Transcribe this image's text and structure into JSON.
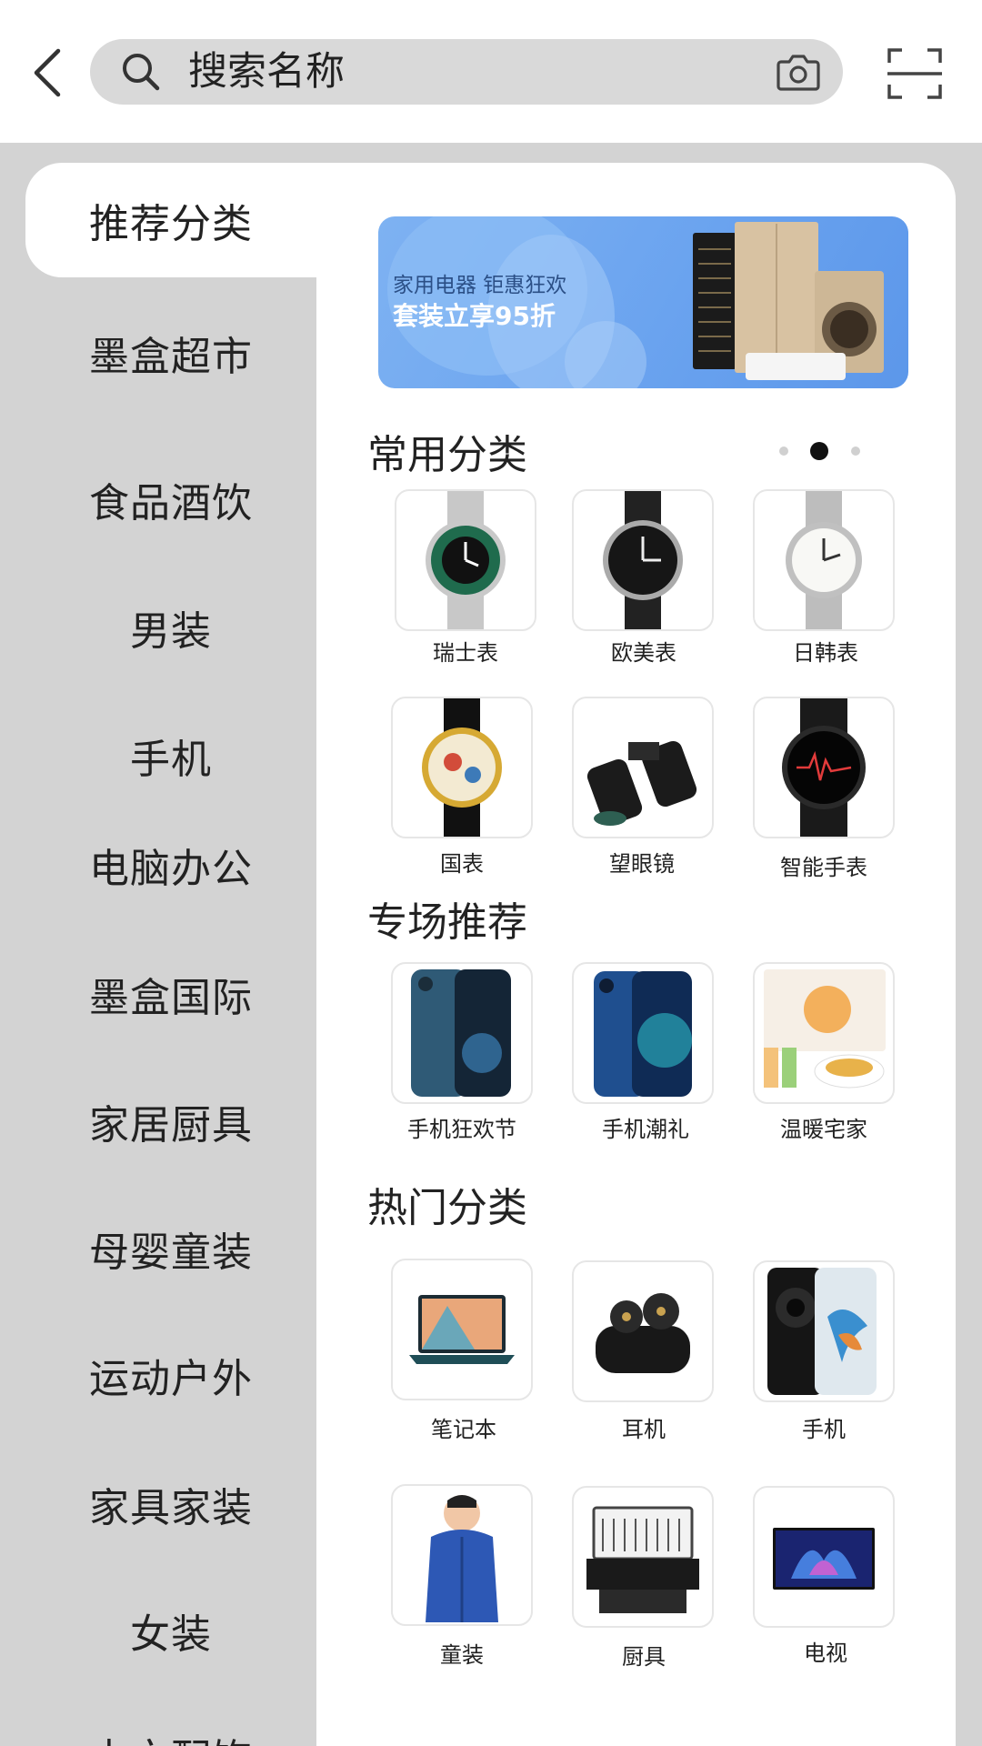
{
  "search": {
    "placeholder": "搜索名称"
  },
  "sidebar": {
    "items": [
      {
        "label": "推荐分类",
        "active": true
      },
      {
        "label": "墨盒超市"
      },
      {
        "label": "食品酒饮"
      },
      {
        "label": "男装"
      },
      {
        "label": "手机"
      },
      {
        "label": "电脑办公"
      },
      {
        "label": "墨盒国际"
      },
      {
        "label": "家居厨具"
      },
      {
        "label": "母婴童装"
      },
      {
        "label": "运动户外"
      },
      {
        "label": "家具家装"
      },
      {
        "label": "女装"
      },
      {
        "label": "中文配饰"
      }
    ]
  },
  "banner": {
    "line1": "家用电器 钜惠狂欢",
    "line2": "套装立享95折"
  },
  "sections": {
    "common": {
      "title": "常用分类",
      "active_page": 2,
      "pages": 3,
      "items": [
        {
          "label": "瑞士表",
          "icon": "watch-green-icon"
        },
        {
          "label": "欧美表",
          "icon": "watch-black-icon"
        },
        {
          "label": "日韩表",
          "icon": "watch-white-icon"
        },
        {
          "label": "国表",
          "icon": "watch-gold-icon"
        },
        {
          "label": "望眼镜",
          "icon": "binoculars-icon"
        },
        {
          "label": "智能手表",
          "icon": "smartwatch-icon"
        }
      ]
    },
    "special": {
      "title": "专场推荐",
      "items": [
        {
          "label": "手机狂欢节",
          "icon": "phone-blue-icon"
        },
        {
          "label": "手机潮礼",
          "icon": "phone-navy-icon"
        },
        {
          "label": "温暖宅家",
          "icon": "tea-box-icon"
        }
      ]
    },
    "hot": {
      "title": "热门分类",
      "items": [
        {
          "label": "笔记本",
          "icon": "laptop-icon"
        },
        {
          "label": "耳机",
          "icon": "earbuds-icon"
        },
        {
          "label": "手机",
          "icon": "phone-mate-icon"
        },
        {
          "label": "童装",
          "icon": "kids-jacket-icon"
        },
        {
          "label": "厨具",
          "icon": "dishwasher-icon"
        },
        {
          "label": "电视",
          "icon": "tv-icon"
        }
      ]
    }
  }
}
